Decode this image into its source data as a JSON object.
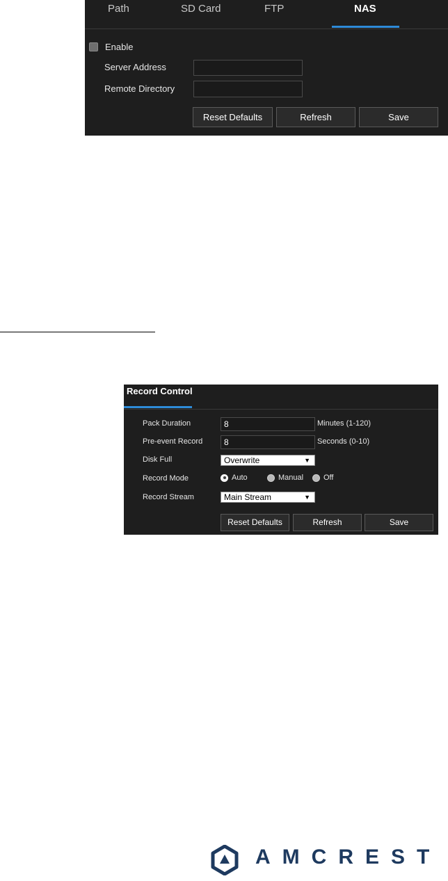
{
  "nas_panel": {
    "tabs": [
      {
        "label": "Path"
      },
      {
        "label": "SD Card"
      },
      {
        "label": "FTP"
      },
      {
        "label": "NAS"
      }
    ],
    "active_tab": "NAS",
    "enable_label": "Enable",
    "enable_checked": false,
    "fields": {
      "server_address": {
        "label": "Server Address",
        "value": ""
      },
      "remote_directory": {
        "label": "Remote Directory",
        "value": ""
      }
    },
    "buttons": {
      "reset_label": "Reset Defaults",
      "refresh_label": "Refresh",
      "save_label": "Save"
    }
  },
  "record_control": {
    "title": "Record Control",
    "pack_duration": {
      "label": "Pack Duration",
      "value": "8",
      "hint": "Minutes (1-120)"
    },
    "pre_event_record": {
      "label": "Pre-event Record",
      "value": "8",
      "hint": "Seconds (0-10)"
    },
    "disk_full": {
      "label": "Disk Full",
      "value": "Overwrite"
    },
    "record_mode": {
      "label": "Record Mode",
      "options": [
        "Auto",
        "Manual",
        "Off"
      ],
      "selected": "Auto"
    },
    "record_stream": {
      "label": "Record Stream",
      "value": "Main Stream"
    },
    "buttons": {
      "reset_label": "Reset Defaults",
      "refresh_label": "Refresh",
      "save_label": "Save"
    }
  },
  "logo": {
    "text": "AMCREST",
    "color": "#1e3a5f"
  },
  "colors": {
    "panel_background": "#1e1e1e",
    "accent_blue": "#2e8bd8"
  }
}
